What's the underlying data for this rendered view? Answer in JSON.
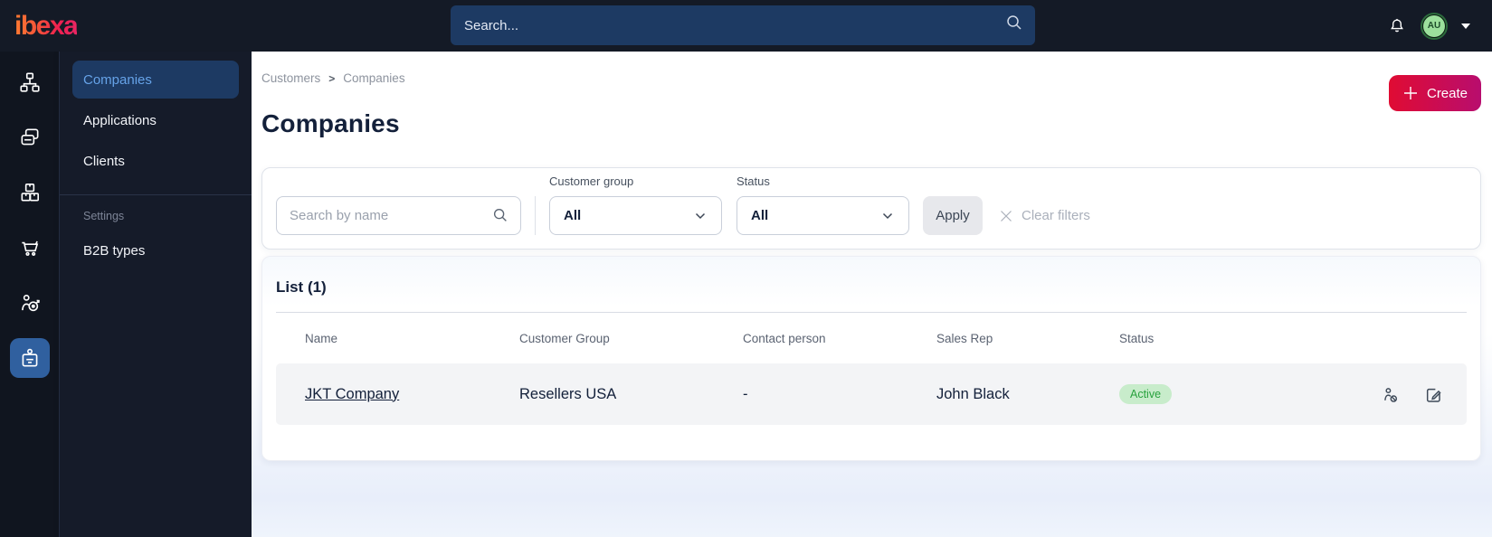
{
  "topbar": {
    "logo_text": "ibexa",
    "search_placeholder": "Search...",
    "avatar_initials": "AU"
  },
  "sidebar": {
    "rail_icons": [
      "sitemap",
      "content-cards",
      "product-boxes",
      "shopping-cart",
      "audience-target",
      "customer-badge"
    ],
    "menu": {
      "items": [
        {
          "label": "Companies",
          "active": true
        },
        {
          "label": "Applications",
          "active": false
        },
        {
          "label": "Clients",
          "active": false
        }
      ],
      "section_label": "Settings",
      "section_items": [
        {
          "label": "B2B types"
        }
      ]
    }
  },
  "main": {
    "breadcrumb": {
      "items": [
        "Customers",
        "Companies"
      ],
      "separator": ">"
    },
    "create_label": "Create",
    "page_title": "Companies",
    "filters": {
      "search_placeholder": "Search by name",
      "customer_group": {
        "label": "Customer group",
        "value": "All"
      },
      "status": {
        "label": "Status",
        "value": "All"
      },
      "apply_label": "Apply",
      "clear_label": "Clear filters"
    },
    "list": {
      "title": "List (1)",
      "columns": [
        "Name",
        "Customer Group",
        "Contact person",
        "Sales Rep",
        "Status"
      ],
      "rows": [
        {
          "name": "JKT Company",
          "customer_group": "Resellers USA",
          "contact_person": "-",
          "sales_rep": "John Black",
          "status": "Active"
        }
      ]
    }
  },
  "colors": {
    "topbar-bg": "#141a26",
    "rail-bg": "#10151f",
    "menu-bg": "#151b29",
    "accent-red": "#e00c33",
    "accent-magenta": "#b80d6e",
    "menu-active-bg": "#1d3a63",
    "menu-active-text": "#66a3e8",
    "badge-bg": "#c8eccb",
    "badge-text": "#28a23d",
    "navy": "#13203a"
  }
}
